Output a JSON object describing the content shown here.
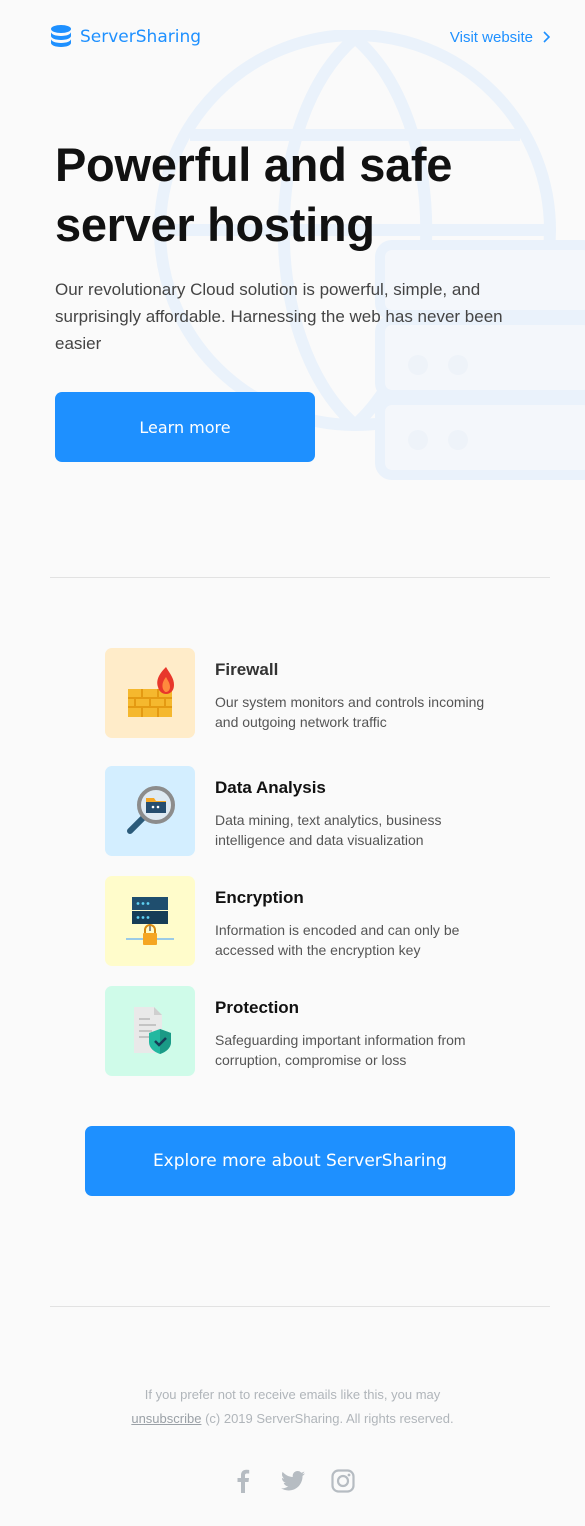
{
  "header": {
    "brand": "ServerSharing",
    "visit_label": "Visit website"
  },
  "hero": {
    "title": "Powerful and safe server hosting",
    "description": "Our revolutionary Cloud solution is powerful, simple, and surprisingly affordable. Harnessing the web has never been easier",
    "cta_label": "Learn more"
  },
  "features": [
    {
      "title": "Firewall",
      "description": "Our system monitors and controls incoming and outgoing network traffic",
      "icon": "firewall-icon",
      "bg": "#ffecc9"
    },
    {
      "title": "Data Analysis",
      "description": "Data mining, text analytics, business intelligence and data visualization",
      "icon": "magnifier-folder-icon",
      "bg": "#d3eeff"
    },
    {
      "title": "Encryption",
      "description": "Information is encoded and can only be accessed with the encryption key",
      "icon": "server-lock-icon",
      "bg": "#fffccb"
    },
    {
      "title": "Protection",
      "description": "Safeguarding important information from corruption, compromise or loss",
      "icon": "document-shield-icon",
      "bg": "#cffbe9"
    }
  ],
  "explore_label": "Explore more about ServerSharing",
  "footer": {
    "line1": "If you prefer not to receive emails like this, you may",
    "unsubscribe_label": "unsubscribe",
    "line2_rest": "(c) 2019 ServerSharing. All rights reserved.",
    "social": [
      "facebook-icon",
      "twitter-icon",
      "instagram-icon"
    ]
  },
  "colors": {
    "accent": "#1e90ff",
    "background": "#fafafa"
  }
}
